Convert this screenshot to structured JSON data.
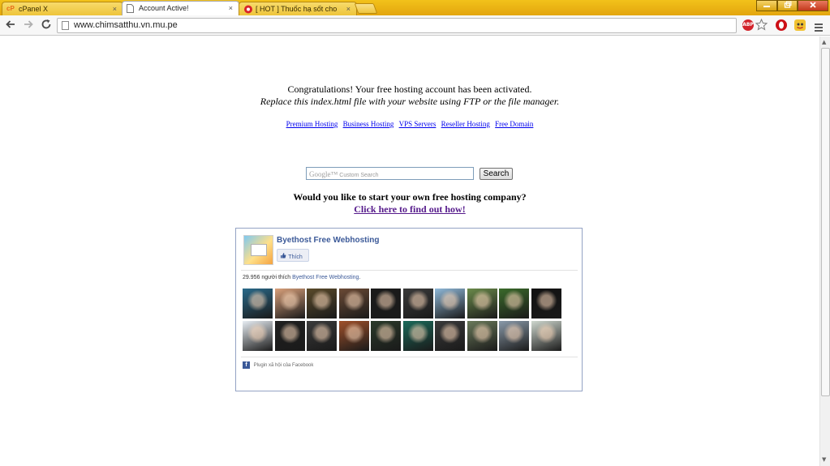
{
  "browser": {
    "tabs": [
      {
        "label": "cPanel X",
        "favicon": "cP"
      },
      {
        "label": "Account Active!",
        "favicon": ""
      },
      {
        "label": "[ HOT ] Thuốc hạ sốt cho",
        "favicon": ""
      }
    ],
    "close_glyph": "×",
    "address": "www.chimsatthu.vn.mu.pe",
    "ext_abp_label": "ABP",
    "icons": [
      "back-arrow-icon",
      "forward-arrow-icon",
      "reload-icon",
      "page-icon",
      "adblock-icon",
      "star-icon",
      "opera-icon",
      "extension-icon",
      "menu-icon"
    ]
  },
  "page": {
    "congrats_text": "Congratulations! Your free hosting account has been activated.",
    "replace_text": "Replace this index.html file with your website using FTP or the file manager.",
    "host_links": [
      "Premium Hosting",
      "Business Hosting",
      "VPS Servers",
      "Reseller Hosting",
      "Free Domain"
    ],
    "search": {
      "placeholder_brand": "Google™",
      "placeholder": "Custom Search",
      "button_label": "Search"
    },
    "promo_question": "Would you like to start your own free hosting company?",
    "promo_link": "Click here to find out how!"
  },
  "fb": {
    "page_name": "Byethost Free Webhosting",
    "like_button": "Thích",
    "like_count": "29.956",
    "likes_text": "người thích",
    "likes_page": "Byethost Free Webhosting",
    "plugin_label": "Plugin xã hội của Facebook",
    "face_colors": [
      [
        "#2a6a8a",
        "#d9a07a",
        "#5a4a2a",
        "#6b4a35",
        "#1a1a1a",
        "#3a3a3a",
        "#8fb8d8",
        "#6a8a4a",
        "#3a6a2a",
        "#111111"
      ],
      [
        "#e8eef4",
        "#202020",
        "#3a3a3a",
        "#a0502a",
        "#2a3a2a",
        "#1a6a5a",
        "#3a3a3a",
        "#6a7a5a",
        "#8a9aaa",
        "#cfd8cf"
      ]
    ]
  },
  "colors": {
    "link": "#0000ee",
    "visited": "#551a8b",
    "fb_blue": "#3b5998"
  }
}
